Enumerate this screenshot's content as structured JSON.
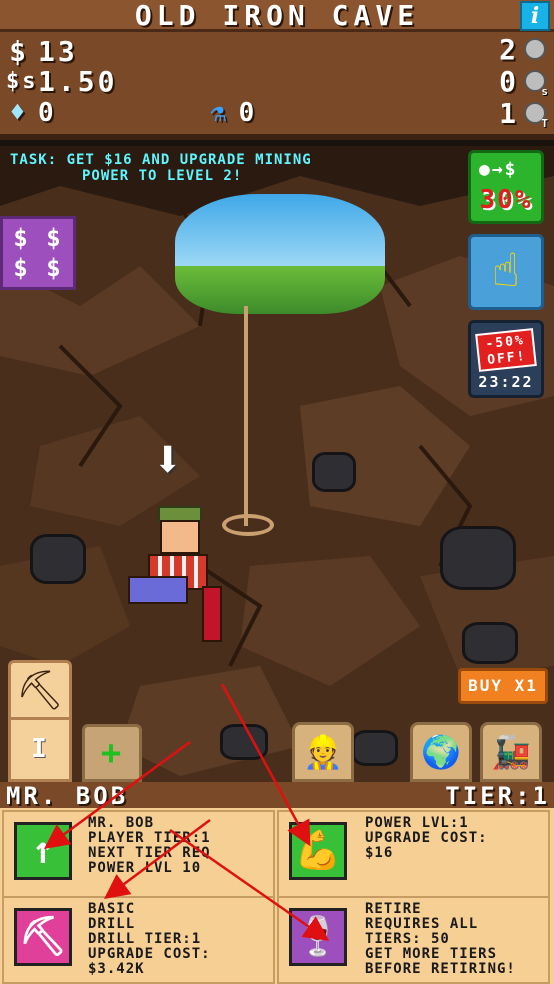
{
  "header": {
    "title": "OLD IRON CAVE",
    "info_label": "i",
    "money_value": "13",
    "money_icon": "$",
    "rate_value": "1.50",
    "rate_icon": "$s",
    "gems_value": "0",
    "potions_value": "0",
    "ore_counts": [
      "2",
      "0",
      "1"
    ],
    "ore_badges": [
      "",
      "s",
      "T"
    ]
  },
  "task": {
    "line1": "TASK: GET $16 AND UPGRADE MINING",
    "line2": "POWER TO LEVEL 2!"
  },
  "side": {
    "dollar_label": "$ $\n$ $",
    "sell_boost_pct": "30%",
    "sale_tag": "-50% OFF!",
    "sale_timer": "23:22"
  },
  "scene": {
    "buy_label": "BUY X1",
    "slot_label": "I",
    "add_label": "+"
  },
  "panel": {
    "character_name": "MR. BOB",
    "tier_label": "TIER:1",
    "cards": {
      "player": "MR. BOB\nPLAYER TIER:1\nNEXT TIER REQ\nPOWER LVL 10",
      "power": "POWER LVL:1\nUPGRADE COST:\n$16",
      "drill": "BASIC\nDRILL\nDRILL TIER:1\nUPGRADE COST:\n$3.42K",
      "retire": "RETIRE\nREQUIRES ALL\nTIERS: 50\nGET MORE TIERS\nBEFORE RETIRING!"
    }
  },
  "colors": {
    "accent_cyan": "#5ff5ff",
    "panel_bg": "#f5cf94",
    "green_button": "#2db42d",
    "purple_button": "#9c4fbd",
    "arrow_red": "#e01010"
  }
}
